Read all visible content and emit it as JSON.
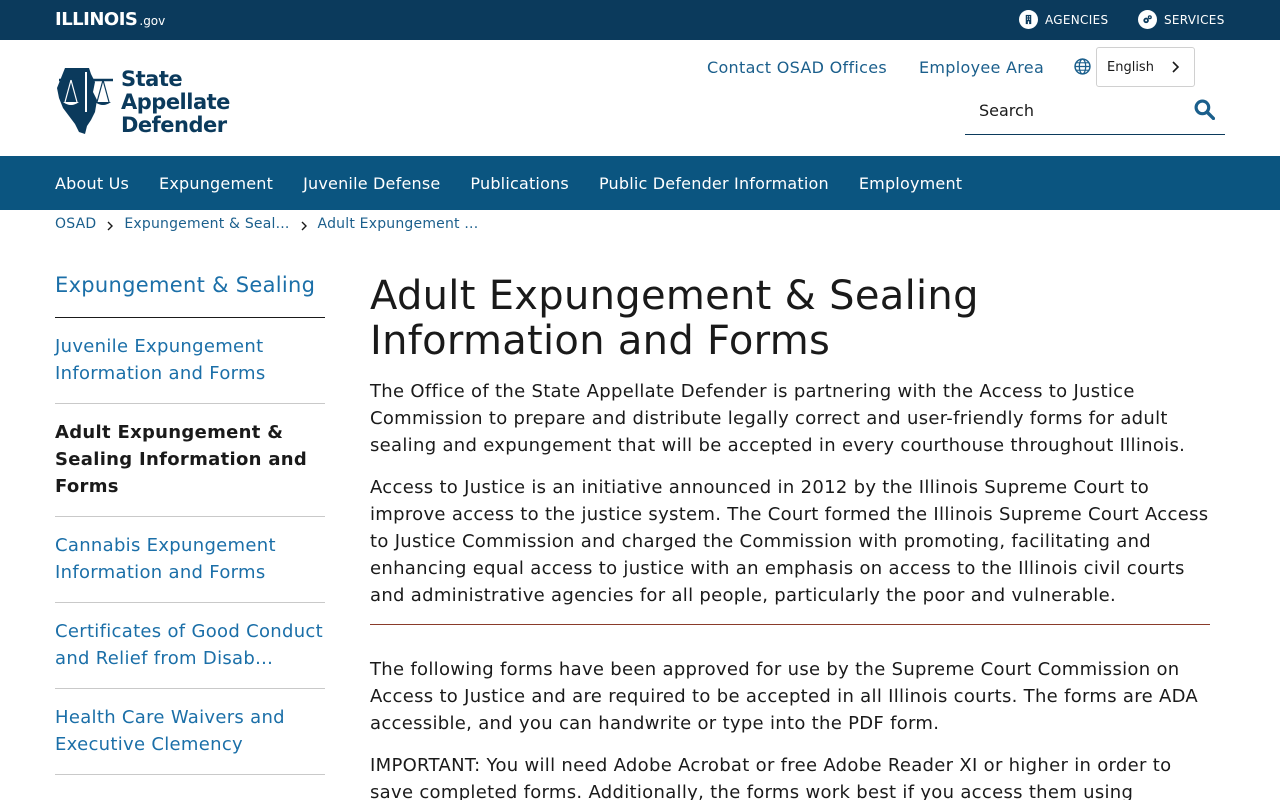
{
  "topbar": {
    "logo_text": "ILLINOIS",
    "logo_suffix": ".gov",
    "agencies_label": "AGENCIES",
    "services_label": "SERVICES"
  },
  "header": {
    "brand_line1": "State",
    "brand_line2": "Appellate",
    "brand_line3": "Defender",
    "contact_link": "Contact OSAD Offices",
    "employee_link": "Employee Area",
    "language": "English",
    "search_placeholder": "Search"
  },
  "nav": {
    "items": [
      "About Us",
      "Expungement",
      "Juvenile Defense",
      "Publications",
      "Public Defender Information",
      "Employment"
    ]
  },
  "breadcrumb": [
    "OSAD",
    "Expungement & Seal...",
    "Adult Expungement ..."
  ],
  "sidebar": {
    "title": "Expungement & Sealing",
    "items": [
      "Juvenile Expungement Information and Forms",
      "Adult Expungement & Sealing Information and Forms",
      "Cannabis Expungement Information and Forms",
      "Certificates of Good Conduct and Relief from Disab...",
      "Health Care Waivers and Executive Clemency"
    ]
  },
  "main": {
    "title": "Adult Expungement & Sealing Information and Forms",
    "paragraphs": [
      "The Office of the State Appellate Defender is partnering with the Access to Justice Commission to prepare and distribute legally correct and user-friendly forms for adult sealing and expungement that will be accepted in every courthouse throughout Illinois.",
      "Access to Justice is an initiative announced in 2012 by the Illinois Supreme Court to improve access to the justice system. The Court formed the Illinois Supreme Court Access to Justice Commission and charged the Commission with promoting, facilitating and enhancing equal access to justice with an emphasis on access to the Illinois civil courts and administrative agencies for all people, particularly the poor and vulnerable.",
      "The following forms have been approved for use by the Supreme Court Commission on Access to Justice and are required to be accepted in all Illinois courts. The forms are ADA accessible, and you can handwrite or type into the PDF form.",
      "IMPORTANT: You will need Adobe Acrobat or free Adobe Reader XI or higher in order to save completed forms. Additionally, the forms work best if you access them using"
    ]
  },
  "colors": {
    "topbar": "#0b3a5c",
    "nav": "#0b5580",
    "link": "#1b6fa8",
    "divider": "#8a3b2a"
  }
}
